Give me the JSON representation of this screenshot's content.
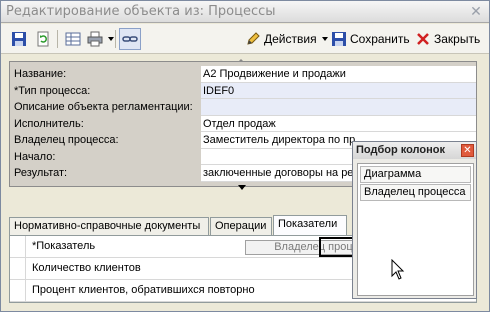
{
  "window": {
    "title": "Редактирование объекта из: Процессы"
  },
  "toolbar": {
    "actions_label": "Действия",
    "save_label": "Сохранить",
    "close_label": "Закрыть"
  },
  "properties": [
    {
      "name": "Название:",
      "value": "A2 Продвижение и продажи"
    },
    {
      "name": "*Тип процесса:",
      "value": "IDEF0"
    },
    {
      "name": "Описание объекта регламентации:",
      "value": ""
    },
    {
      "name": "Исполнитель:",
      "value": "Отдел продаж"
    },
    {
      "name": "Владелец процесса:",
      "value": "Заместитель директора по пр"
    },
    {
      "name": "Начало:",
      "value": ""
    },
    {
      "name": "Результат:",
      "value": "заключенные договоры на ре"
    }
  ],
  "tabs": [
    {
      "label": "Нормативно-справочные документы"
    },
    {
      "label": "Операции"
    },
    {
      "label": "Показатели"
    }
  ],
  "grid": {
    "header": "*Показатель",
    "rows": [
      {
        "label": "Количество клиентов"
      },
      {
        "label": "Процент клиентов, обратившихся повторно"
      }
    ]
  },
  "drag_ghost_label": "Владелец процесса",
  "column_picker": {
    "title": "Подбор колонок",
    "items": [
      "Диаграмма",
      "Владелец процесса"
    ]
  }
}
